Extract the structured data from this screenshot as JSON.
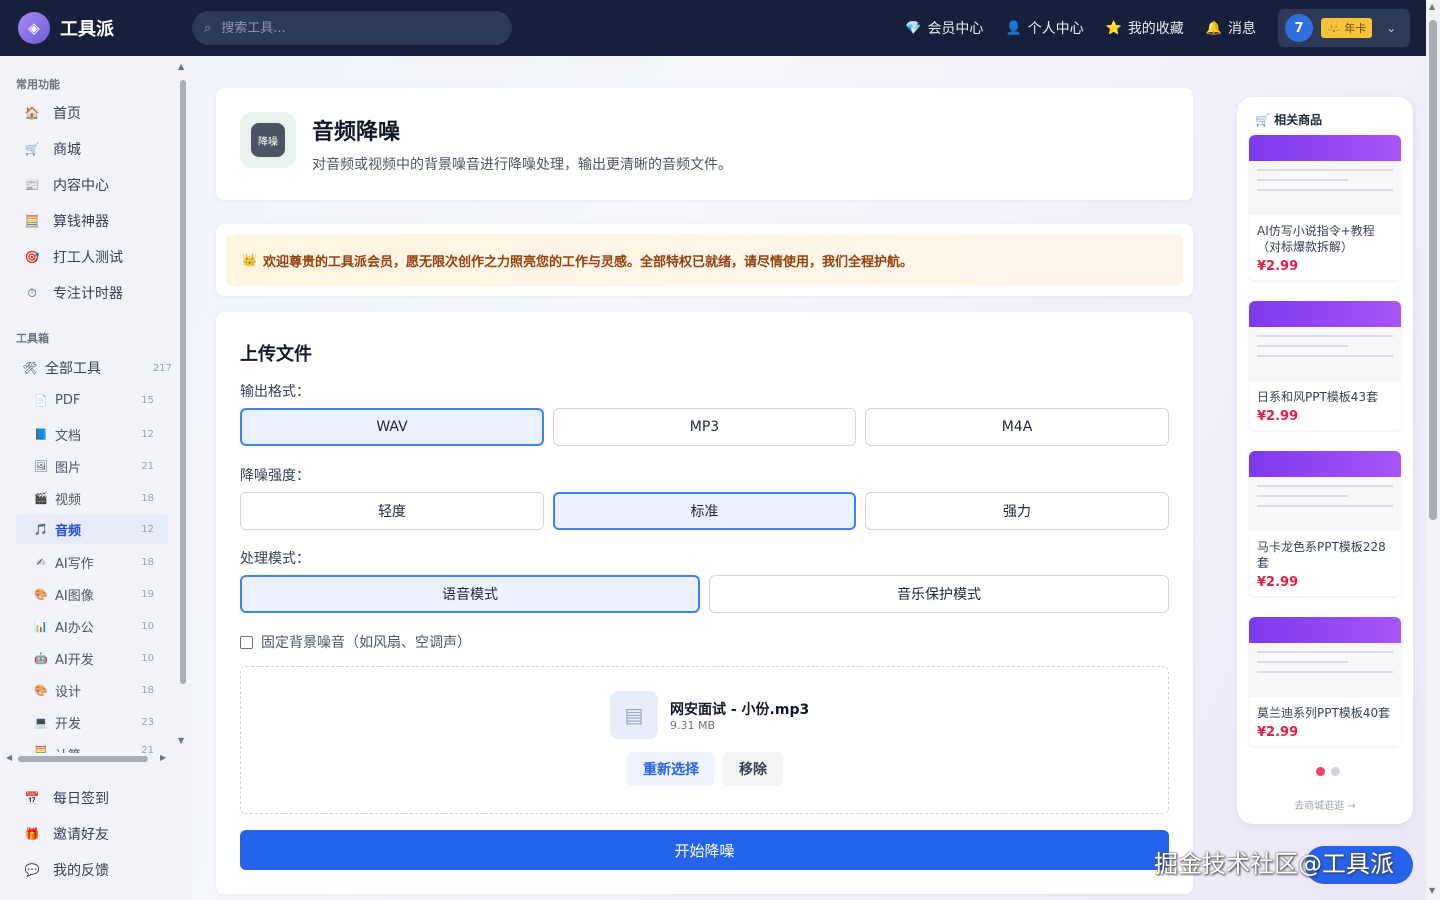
{
  "header": {
    "logo_text": "工具派",
    "search_placeholder": "搜索工具...",
    "nav": [
      {
        "label": "会员中心",
        "icon": "diamond-icon",
        "glyph": "💎"
      },
      {
        "label": "个人中心",
        "icon": "user-icon",
        "glyph": "👤"
      },
      {
        "label": "我的收藏",
        "icon": "star-icon",
        "glyph": "⭐"
      },
      {
        "label": "消息",
        "icon": "bell-icon",
        "glyph": "🔔"
      }
    ],
    "user": {
      "avatar": "7",
      "vip_badge": "年卡"
    }
  },
  "sidebar": {
    "section_common": "常用功能",
    "common_items": [
      {
        "label": "首页",
        "glyph": "🏠"
      },
      {
        "label": "商城",
        "glyph": "🛒"
      },
      {
        "label": "内容中心",
        "glyph": "📰"
      },
      {
        "label": "算钱神器",
        "glyph": "🧮"
      },
      {
        "label": "打工人测试",
        "glyph": "🎯"
      },
      {
        "label": "专注计时器",
        "glyph": "⏱"
      }
    ],
    "section_tools": "工具箱",
    "all_tools": {
      "label": "全部工具",
      "count": "217",
      "glyph": "🛠"
    },
    "tool_items": [
      {
        "label": "PDF",
        "count": "15",
        "glyph": "📄"
      },
      {
        "label": "文档",
        "count": "12",
        "glyph": "📘"
      },
      {
        "label": "图片",
        "count": "21",
        "glyph": "🖼"
      },
      {
        "label": "视频",
        "count": "18",
        "glyph": "🎬"
      },
      {
        "label": "音频",
        "count": "12",
        "glyph": "🎵"
      },
      {
        "label": "AI写作",
        "count": "18",
        "glyph": "✍"
      },
      {
        "label": "AI图像",
        "count": "19",
        "glyph": "🎨"
      },
      {
        "label": "AI办公",
        "count": "10",
        "glyph": "📊"
      },
      {
        "label": "AI开发",
        "count": "10",
        "glyph": "🤖"
      },
      {
        "label": "设计",
        "count": "18",
        "glyph": "🎨"
      },
      {
        "label": "开发",
        "count": "23",
        "glyph": "💻"
      },
      {
        "label": "计算",
        "count": "21",
        "glyph": "🧮"
      }
    ],
    "active_tool": "音频",
    "bottom_items": [
      {
        "label": "每日签到",
        "glyph": "📅"
      },
      {
        "label": "邀请好友",
        "glyph": "🎁"
      },
      {
        "label": "我的反馈",
        "glyph": "💬"
      }
    ]
  },
  "tool": {
    "icon_text": "降噪",
    "title": "音频降噪",
    "description": "对音频或视频中的背景噪音进行降噪处理，输出更清晰的音频文件。"
  },
  "notice": "欢迎尊贵的工具派会员，愿无限次创作之力照亮您的工作与灵感。全部特权已就绪，请尽情使用，我们全程护航。",
  "upload": {
    "title": "上传文件",
    "output_format_label": "输出格式：",
    "output_formats": [
      "WAV",
      "MP3",
      "M4A"
    ],
    "output_selected": "WAV",
    "strength_label": "降噪强度：",
    "strengths": [
      "轻度",
      "标准",
      "强力"
    ],
    "strength_selected": "标准",
    "mode_label": "处理模式：",
    "modes": [
      "语音模式",
      "音乐保护模式"
    ],
    "mode_selected": "语音模式",
    "fixed_noise_label": "固定背景噪音（如风扇、空调声）",
    "fixed_noise_checked": false,
    "file": {
      "name": "网安面试 - 小份.mp3",
      "size": "9.31 MB"
    },
    "reselect_label": "重新选择",
    "remove_label": "移除",
    "start_label": "开始降噪"
  },
  "related": {
    "title": "相关商品",
    "products": [
      {
        "name": "AI仿写小说指令+教程（对标爆款拆解）",
        "price": "¥2.99"
      },
      {
        "name": "日系和风PPT模板43套",
        "price": "¥2.99"
      },
      {
        "name": "马卡龙色系PPT模板228套",
        "price": "¥2.99"
      },
      {
        "name": "莫兰迪系列PPT模板40套",
        "price": "¥2.99"
      }
    ],
    "more_label": "去商城逛逛 →"
  },
  "watermark": "掘金技术社区@工具派",
  "colors": {
    "accent": "#2563eb",
    "header_bg": "#16203a",
    "price": "#e11d48"
  }
}
